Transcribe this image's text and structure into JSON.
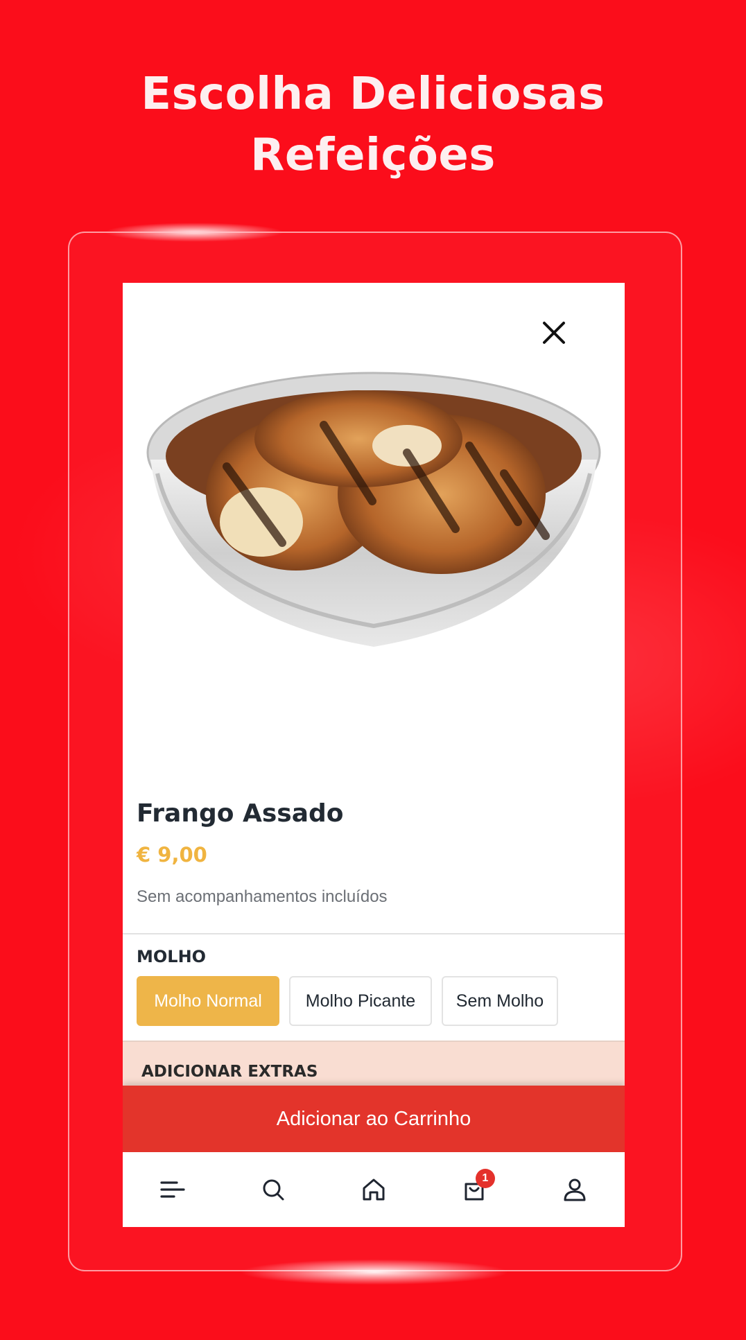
{
  "headline": {
    "line1": "Escolha Deliciosas",
    "line2": "Refeições"
  },
  "product": {
    "name": "Frango Assado",
    "price": "€ 9,00",
    "description": "Sem acompanhamentos incluídos"
  },
  "sauce": {
    "title": "MOLHO",
    "options": [
      "Molho Normal",
      "Molho Picante",
      "Sem Molho"
    ],
    "selected": "Molho Normal"
  },
  "extras": {
    "title": "ADICIONAR EXTRAS"
  },
  "actions": {
    "add_to_cart": "Adicionar ao Carrinho"
  },
  "nav": {
    "cart_count": "1",
    "items": [
      "menu-icon",
      "search-icon",
      "home-icon",
      "cart-icon",
      "profile-icon"
    ]
  },
  "colors": {
    "background": "#fb0d1b",
    "accent": "#eeb549",
    "button": "#e3342b",
    "extras_bg": "#f9ddd2"
  }
}
